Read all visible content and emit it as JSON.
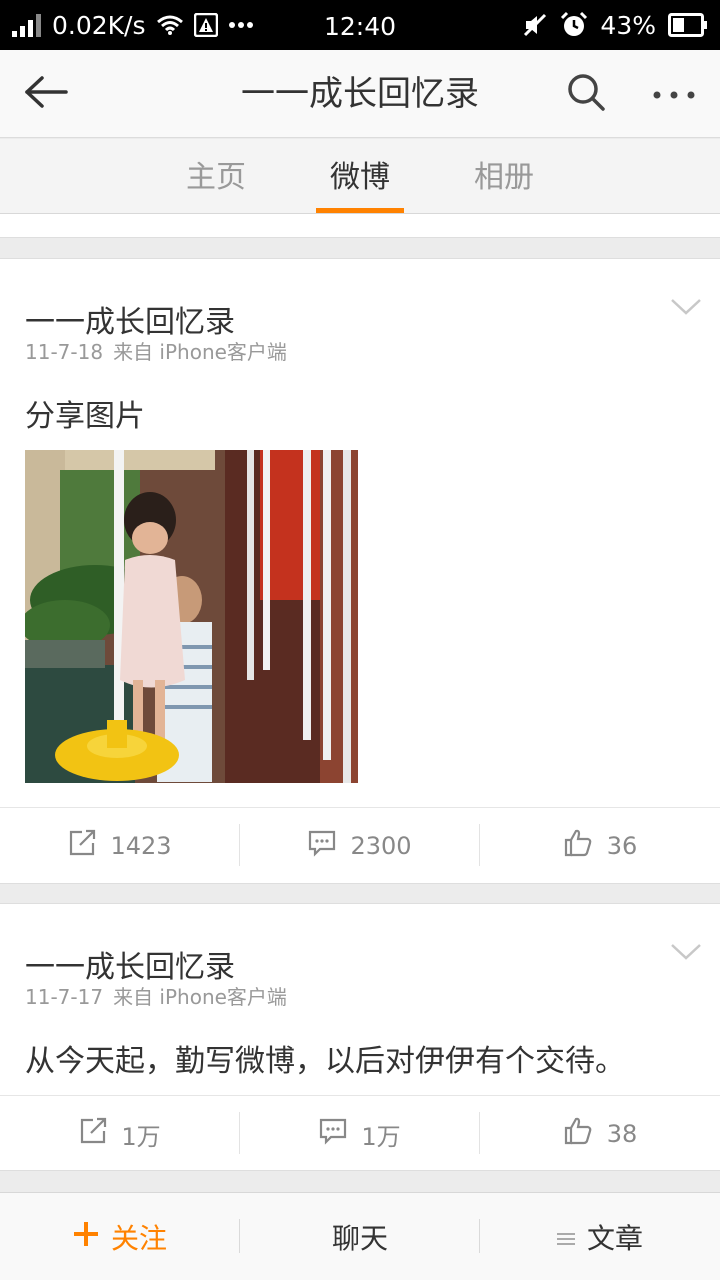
{
  "status_bar": {
    "net_speed": "0.02K/s",
    "time": "12:40",
    "battery_pct": "43%",
    "battery_level": 0.43,
    "icons": [
      "signal-icon",
      "wifi-icon",
      "warning-icon",
      "more-dots-icon",
      "mute-icon",
      "alarm-icon",
      "battery-icon"
    ]
  },
  "nav": {
    "title": "一一成长回忆录",
    "icons": [
      "back-arrow-icon",
      "search-icon",
      "more-icon"
    ]
  },
  "tabs": [
    {
      "label": "主页",
      "active": false
    },
    {
      "label": "微博",
      "active": true
    },
    {
      "label": "相册",
      "active": false
    }
  ],
  "posts": [
    {
      "author": "一一成长回忆录",
      "date": "11-7-18",
      "source": "来自 iPhone客户端",
      "text": "分享图片",
      "has_photo": true,
      "reposts": "1423",
      "comments": "2300",
      "likes": "36"
    },
    {
      "author": "一一成长回忆录",
      "date": "11-7-17",
      "source": "来自 iPhone客户端",
      "text": "从今天起，勤写微博，以后对伊伊有个交待。",
      "has_photo": false,
      "reposts": "1万",
      "comments": "1万",
      "likes": "38"
    }
  ],
  "bottom_bar": {
    "follow_label": "关注",
    "chat_label": "聊天",
    "article_label": "文章"
  },
  "colors": {
    "accent": "#ff8200",
    "text": "#333333",
    "muted": "#999999"
  }
}
